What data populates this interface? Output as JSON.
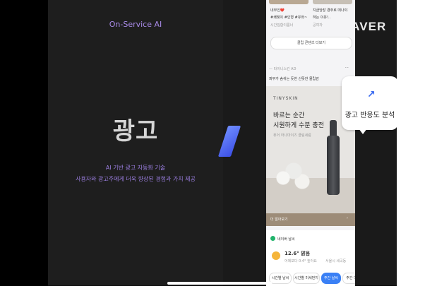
{
  "left": {
    "tag": "On-Service AI",
    "title": "광고",
    "desc1": "AI 기반 광고 자동화 기술",
    "desc2": "사용자와 광고주에게 더욱 향상된 경험과 가치 제공"
  },
  "brand": "NAVER",
  "phone": {
    "item1_title": "내부인❤️",
    "item1_sub": "#쇄빛이 #인형 #유와~",
    "item1_meta": "시간집합이룸너",
    "item2_title": "지금당장 경주로 떠나야",
    "item2_sub": "하는 이유!..",
    "item2_meta": "공여자",
    "more_button": "클립 콘텐츠 더보기",
    "ad_source": "— 타이니스킨  AD",
    "ad_more": "···",
    "ad_caption": "피부가 숨쉬는 듯한 산뜻한 물립감",
    "brand_small": "TINYSKIN",
    "headline1": "바르는 순간",
    "headline2": "시원하게 수분 충전",
    "product_name": "퓨어 하나마이즈 클링세럼",
    "ad_link": "더 알아보기",
    "ad_link_arrow": "›",
    "weather_section": "네이버 날씨",
    "weather_temp": "12.6° 맑음",
    "weather_detail": "어제보다 0.4° 높아요",
    "weather_location": "서울시 세곡동",
    "chips": [
      "시간별 날씨",
      "시간별 미세먼지",
      "주간 날씨",
      "주간 미"
    ]
  },
  "bubble": {
    "icon": "trend-up-icon",
    "label": "광고 반응도 분석"
  },
  "colors": {
    "accent_purple": "#a98be8",
    "accent_blue": "#3a80f5",
    "bg_dark": "#1a1a1a"
  }
}
